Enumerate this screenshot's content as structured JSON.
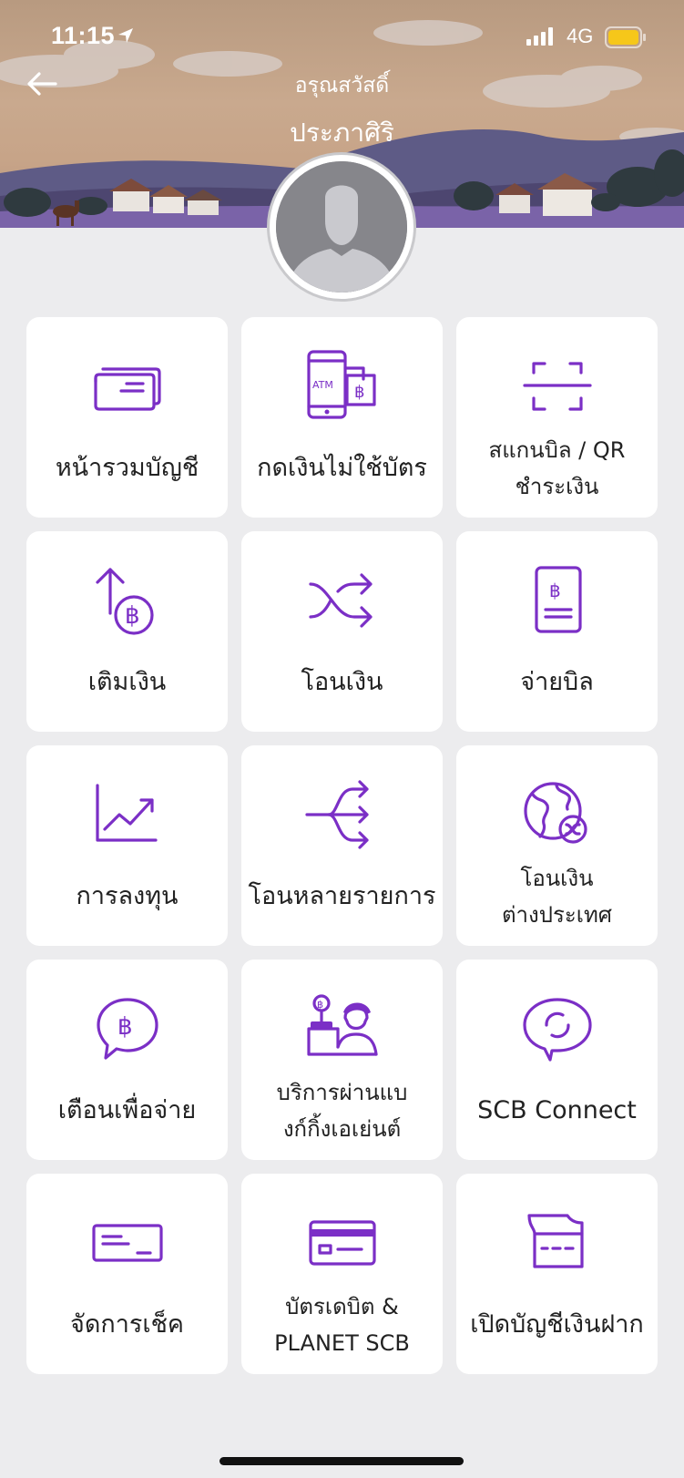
{
  "status_bar": {
    "time": "11:15",
    "network": "4G"
  },
  "header": {
    "greeting": "อรุณสวัสดิ์",
    "user_name": "ประภาศิริ"
  },
  "colors": {
    "accent": "#7b2fc6",
    "battery": "#f6c71a"
  },
  "menu": {
    "items": [
      {
        "label": [
          "หน้ารวมบัญชี"
        ],
        "icon": "account-card-icon"
      },
      {
        "label": [
          "กดเงินไม่ใช้บัตร"
        ],
        "icon": "atm-phone-icon"
      },
      {
        "label": [
          "สแกนบิล / QR",
          "ชำระเงิน"
        ],
        "icon": "scan-icon"
      },
      {
        "label": [
          "เติมเงิน"
        ],
        "icon": "topup-icon"
      },
      {
        "label": [
          "โอนเงิน"
        ],
        "icon": "transfer-icon"
      },
      {
        "label": [
          "จ่ายบิล"
        ],
        "icon": "bill-icon"
      },
      {
        "label": [
          "การลงทุน"
        ],
        "icon": "investment-chart-icon"
      },
      {
        "label": [
          "โอนหลายรายการ"
        ],
        "icon": "multi-transfer-icon"
      },
      {
        "label": [
          "โอนเงิน",
          "ต่างประเทศ"
        ],
        "icon": "globe-transfer-icon"
      },
      {
        "label": [
          "เตือนเพื่อจ่าย"
        ],
        "icon": "payment-reminder-icon"
      },
      {
        "label": [
          "บริการผ่านแบ",
          "งก์กิ้งเอเย่นต์"
        ],
        "icon": "banking-agent-icon"
      },
      {
        "label": [
          "SCB Connect"
        ],
        "icon": "scb-connect-icon"
      },
      {
        "label": [
          "จัดการเช็ค"
        ],
        "icon": "cheque-icon"
      },
      {
        "label": [
          "บัตรเดบิต &",
          "PLANET SCB"
        ],
        "icon": "debit-card-icon"
      },
      {
        "label": [
          "เปิดบัญชีเงินฝาก"
        ],
        "icon": "open-account-icon"
      }
    ]
  }
}
